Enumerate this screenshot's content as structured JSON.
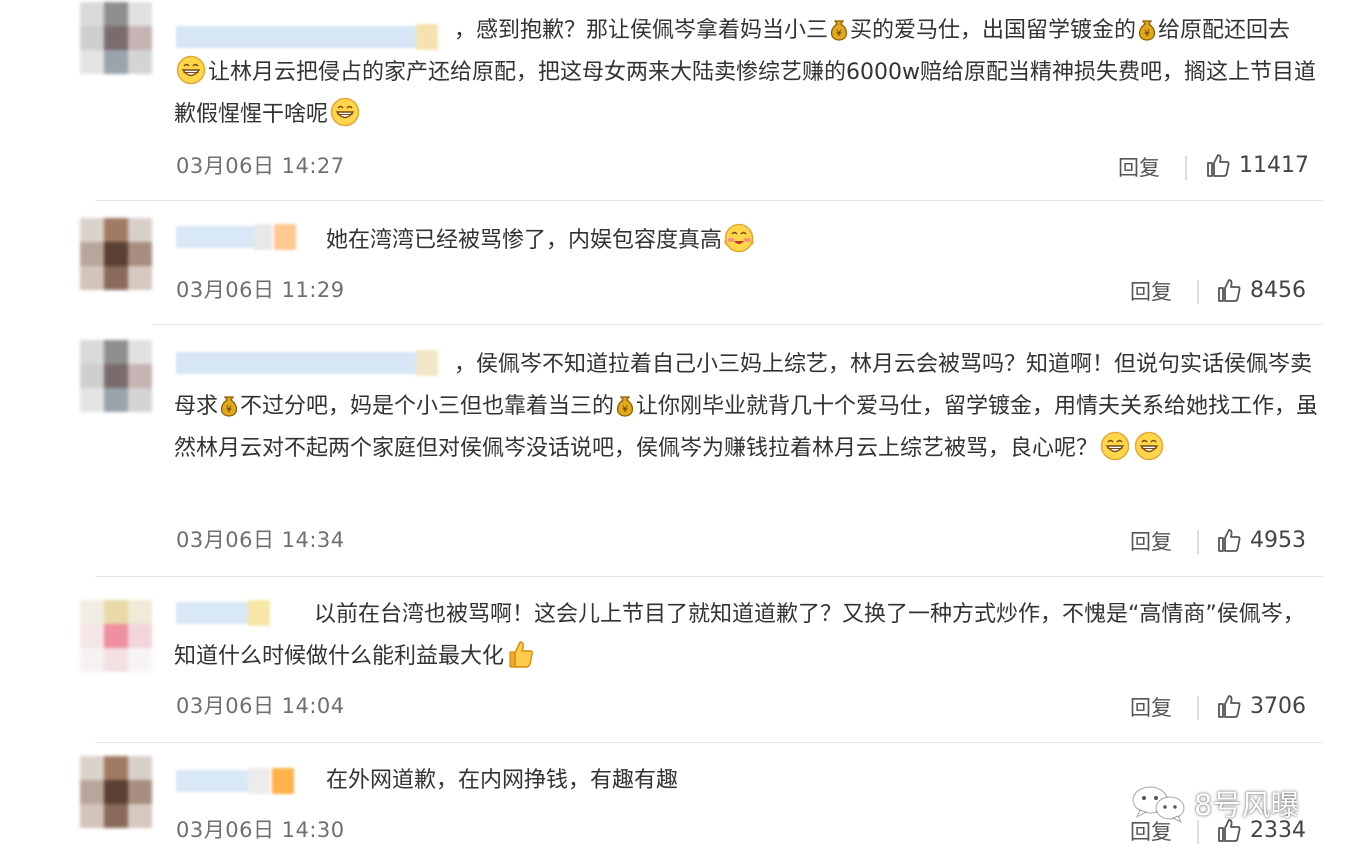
{
  "comments": [
    {
      "segments": [
        "，感到抱歉？那让侯佩岑拿着妈当小三",
        "买的爱马仕，出国留学镀金的",
        "给原配还回去",
        "让林月云把侵占的家产还给原配，把这母女两来大陆卖惨综艺赚的6000w赔给原配当精神损失费吧，搁这上节目道歉假惺惺干啥呢",
        ""
      ],
      "icons": [
        "coin-icon",
        "coin-icon",
        "grin-emoji-icon",
        "grin-emoji-icon"
      ],
      "time": "03月06日 14:27",
      "reply": "回复",
      "likes": "11417"
    },
    {
      "segments": [
        "她在湾湾已经被骂惨了，内娱包容度真高",
        ""
      ],
      "icons": [
        "blush-emoji-icon"
      ],
      "time": "03月06日 11:29",
      "reply": "回复",
      "likes": "8456"
    },
    {
      "segments": [
        "，侯佩岑不知道拉着自己小三妈上综艺，林月云会被骂吗？知道啊！但说句实话侯佩岑卖母求",
        "不过分吧，妈是个小三但也靠着当三的",
        "让你刚毕业就背几十个爱马仕，留学镀金，用情夫关系给她找工作，虽然林月云对不起两个家庭但对侯佩岑没话说吧，侯佩岑为赚钱拉着林月云上综艺被骂，良心呢？",
        "",
        ""
      ],
      "icons": [
        "coin-icon",
        "coin-icon",
        "grin-emoji-icon",
        "grin-emoji-icon"
      ],
      "time": "03月06日 14:34",
      "reply": "回复",
      "likes": "4953"
    },
    {
      "segments": [
        "以前在台湾也被骂啊！这会儿上节目了就知道道歉了？又换了一种方式炒作，不愧是“高情商”侯佩岑，知道什么时候做什么能利益最大化",
        ""
      ],
      "icons": [
        "thumbs-up-emoji-icon"
      ],
      "time": "03月06日 14:04",
      "reply": "回复",
      "likes": "3706"
    },
    {
      "segments": [
        "在外网道歉，在内网挣钱，有趣有趣"
      ],
      "icons": [],
      "time": "03月06日 14:30",
      "reply": "回复",
      "likes": "2334"
    }
  ],
  "watermark": "8号风曝",
  "colors": {
    "text": "#333333",
    "time": "#6f6f6f",
    "emoji_yellow": "#ffd54a",
    "coin_gold": "#e0a81a"
  }
}
